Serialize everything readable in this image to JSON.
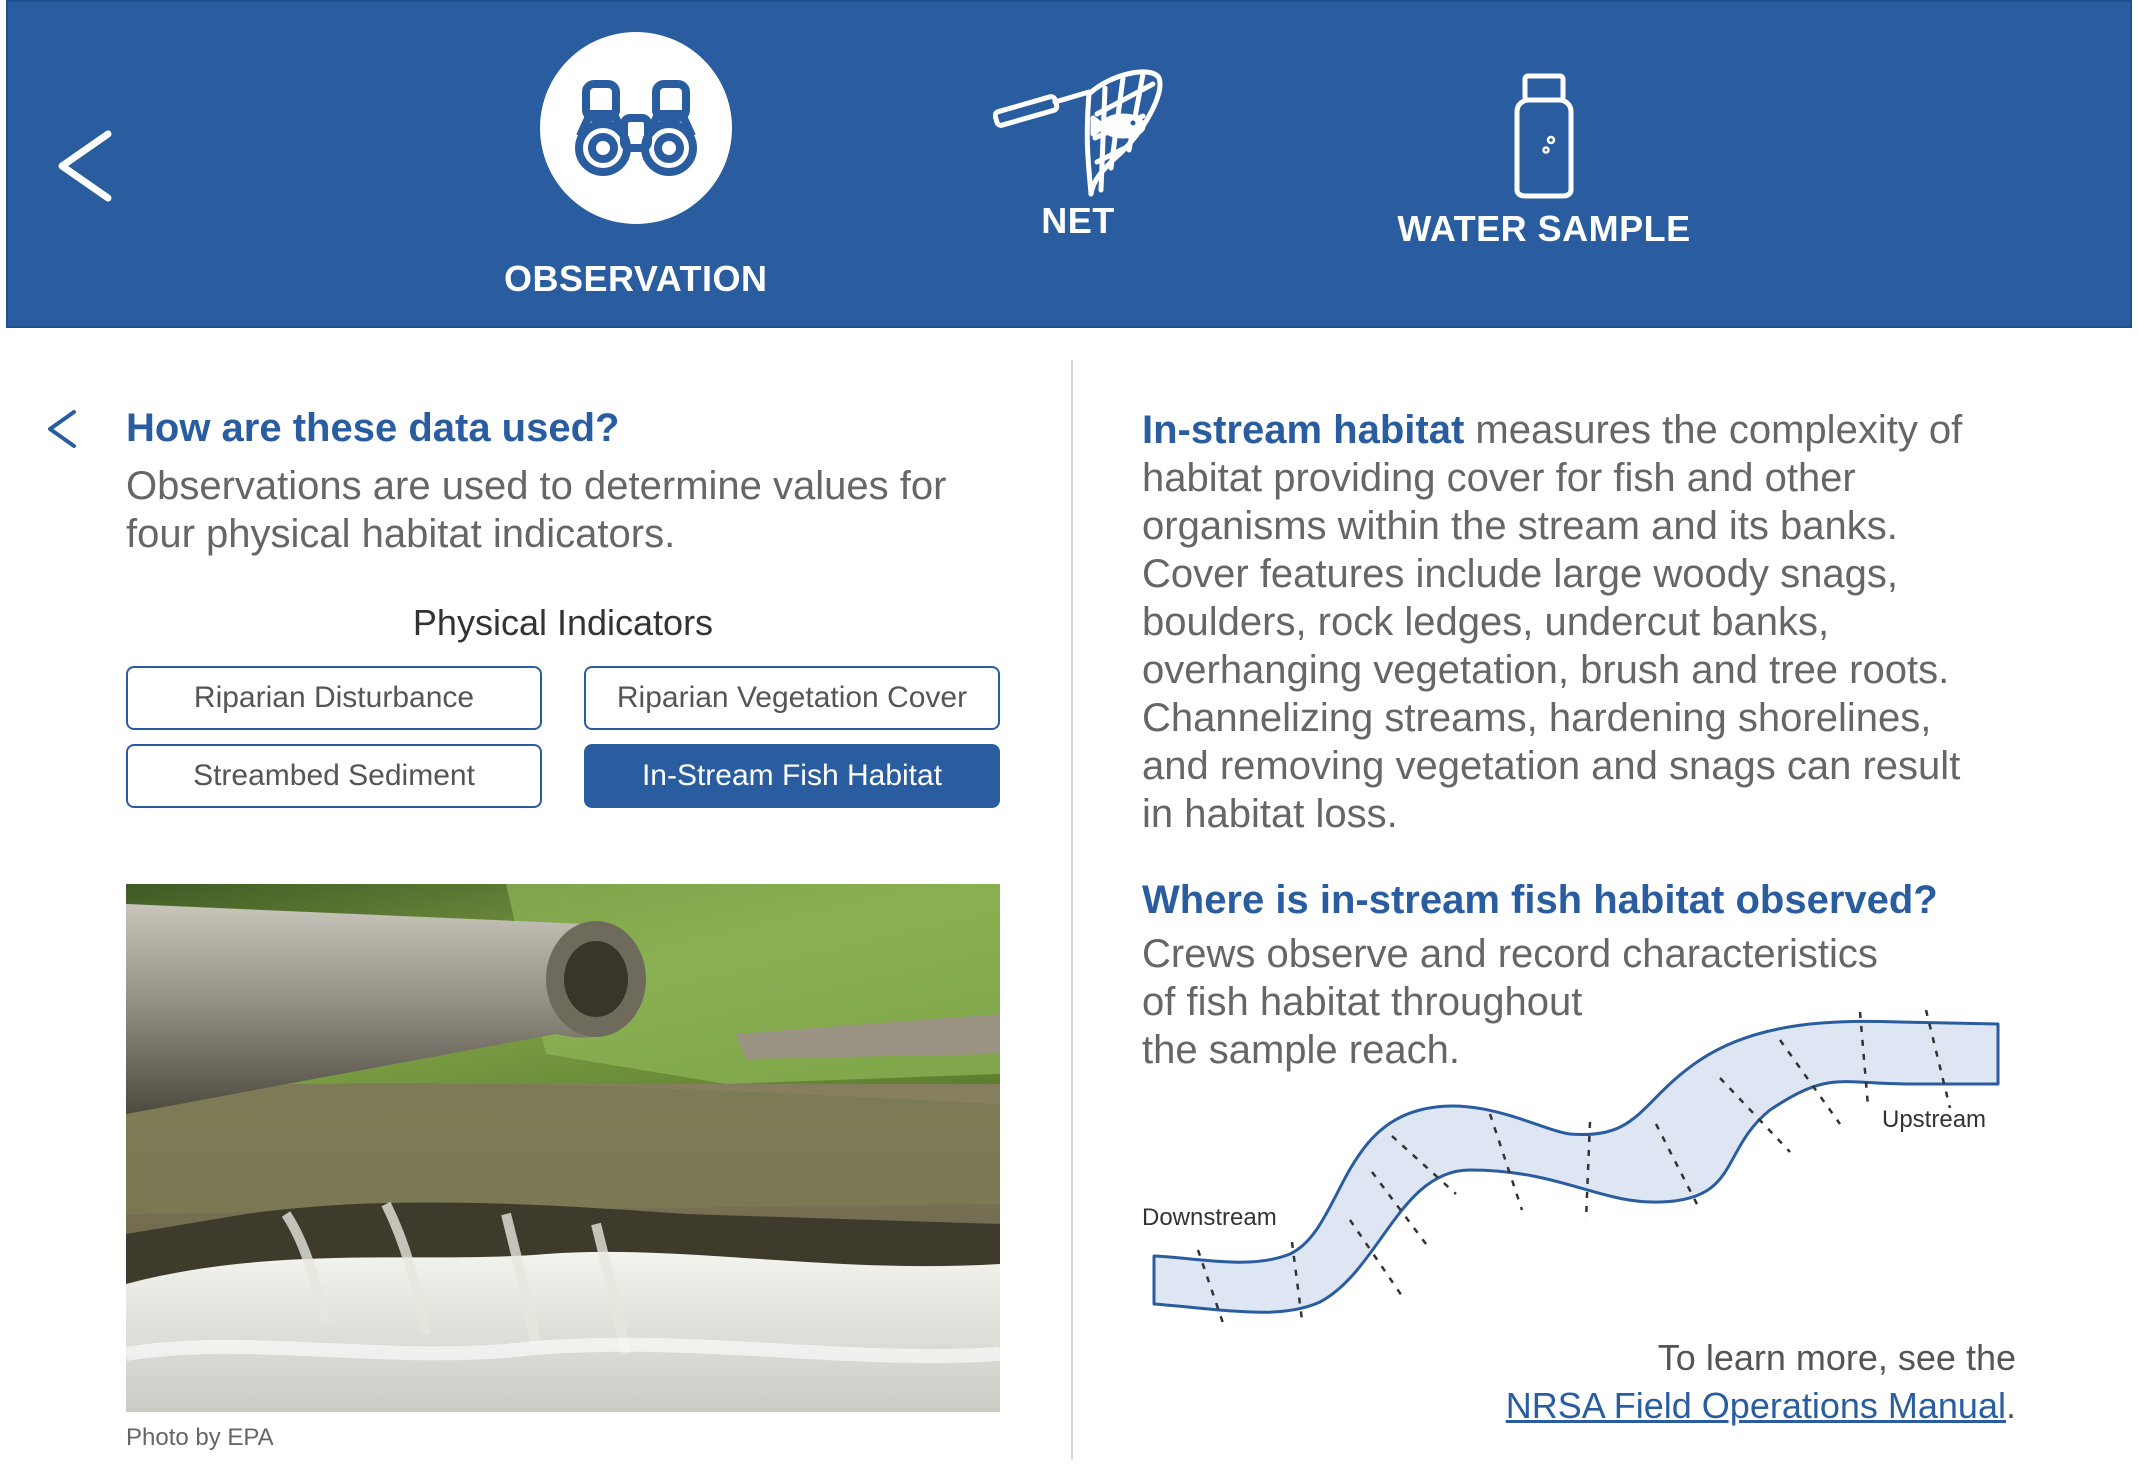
{
  "header": {
    "tabs": [
      {
        "label": "OBSERVATION",
        "icon": "binoculars-icon",
        "active": true
      },
      {
        "label": "NET",
        "icon": "fish-net-icon",
        "active": false
      },
      {
        "label": "WATER SAMPLE",
        "icon": "sample-bottle-icon",
        "active": false
      }
    ]
  },
  "left": {
    "question": "How are these data used?",
    "answer": "Observations are used to determine values for four physical habitat indicators.",
    "indicators_title": "Physical Indicators",
    "indicators": [
      {
        "label": "Riparian Disturbance",
        "active": false
      },
      {
        "label": "Riparian Vegetation Cover",
        "active": false
      },
      {
        "label": "Streambed Sediment",
        "active": false
      },
      {
        "label": "In-Stream Fish Habitat",
        "active": true
      }
    ],
    "photo_credit": "Photo by EPA"
  },
  "right": {
    "lead": "In-stream habitat",
    "body": " measures the complexity of habitat providing cover for fish and other organisms within the stream and its banks. Cover features include large woody snags, boulders, rock ledges, undercut banks, overhanging vegetation, brush and tree roots. Channelizing streams, hardening shorelines, and removing vegetation and snags can result in habitat loss.",
    "where_question": "Where is in-stream fish habitat observed?",
    "where_answer_lines": [
      "Crews observe and record characteristics",
      "of fish habitat throughout",
      "the sample reach."
    ],
    "label_downstream": "Downstream",
    "label_upstream": "Upstream",
    "learn_prefix": "To learn more, see the",
    "learn_link": "NRSA Field Operations Manual",
    "learn_suffix": "."
  },
  "colors": {
    "brand_blue": "#2a5da0",
    "stream_fill": "#dde6f2"
  }
}
